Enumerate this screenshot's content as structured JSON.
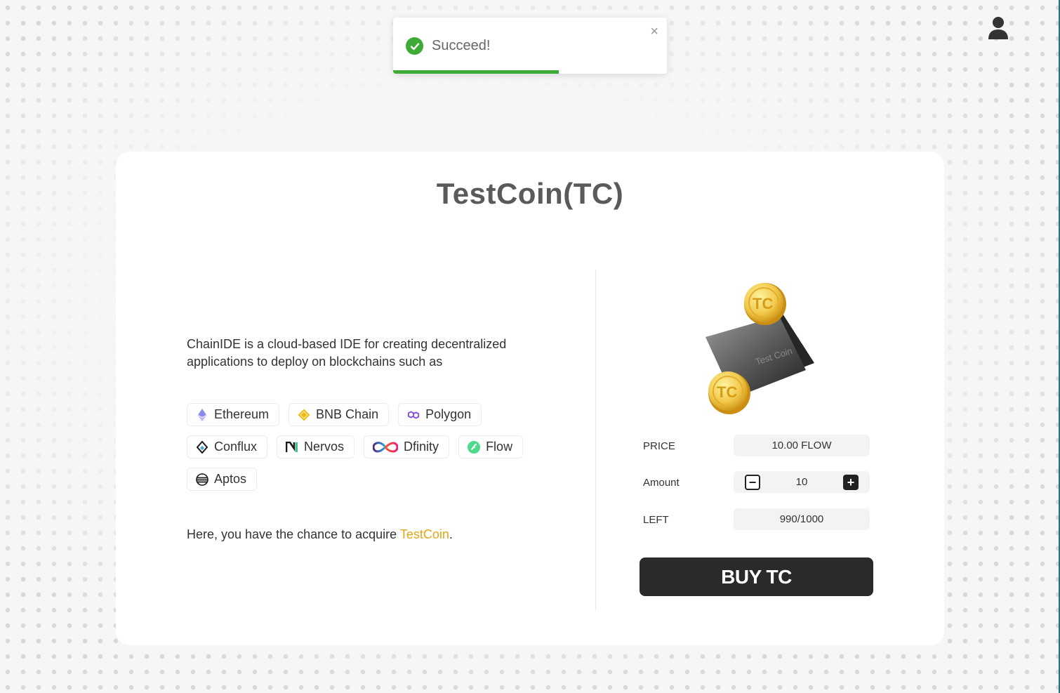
{
  "toast": {
    "message": "Succeed!",
    "close_symbol": "×",
    "status_color": "#3dab35",
    "progress": 0.605
  },
  "header": {
    "user_icon": "user-icon"
  },
  "card": {
    "title": "TestCoin(TC)",
    "description": "ChainIDE is a cloud-based IDE for creating decentralized applications to deploy on blockchains such as",
    "chains": [
      {
        "label": "Ethereum",
        "icon": "ethereum-icon"
      },
      {
        "label": "BNB Chain",
        "icon": "bnb-chain-icon"
      },
      {
        "label": "Polygon",
        "icon": "polygon-icon"
      },
      {
        "label": "Conflux",
        "icon": "conflux-icon"
      },
      {
        "label": "Nervos",
        "icon": "nervos-icon"
      },
      {
        "label": "Dfinity",
        "icon": "dfinity-icon"
      },
      {
        "label": "Flow",
        "icon": "flow-icon"
      },
      {
        "label": "Aptos",
        "icon": "aptos-icon"
      }
    ],
    "acquire_prefix": "Here, you have the chance to acquire ",
    "acquire_highlight": "TestCoin",
    "acquire_suffix": ".",
    "highlight_color": "#e4a514"
  },
  "purchase": {
    "coin_image": {
      "coin_text": "TC",
      "wallet_text": "Test Coin"
    },
    "price_label": "PRICE",
    "price_value": "10.00 FLOW",
    "amount_label": "Amount",
    "amount_value": "10",
    "minus_symbol": "−",
    "plus_symbol": "+",
    "left_label": "LEFT",
    "left_value": "990/1000",
    "buy_label": "BUY TC"
  }
}
